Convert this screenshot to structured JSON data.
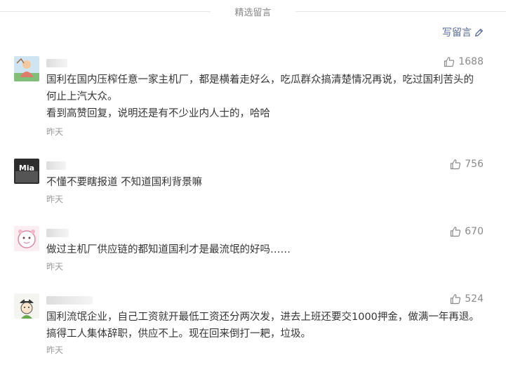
{
  "header": {
    "title": "精选留言"
  },
  "write_comment": {
    "label": "写留言",
    "icon": "pencil-icon"
  },
  "comments": [
    {
      "likes": "1688",
      "content": "国利在国内压榨任意一家主机厂，都是横着走好么，吃瓜群众搞清楚情况再说，吃过国利苦头的何止上汽大众。\n看到高赞回复，说明还是有不少业内人士的，哈哈",
      "time": "昨天"
    },
    {
      "likes": "756",
      "avatar_text": "Mia",
      "content": "不懂不要瞎报道 不知道国利背景嘛",
      "time": "昨天"
    },
    {
      "likes": "670",
      "content": "做过主机厂供应链的都知道国利才是最流氓的好吗……",
      "time": "昨天"
    },
    {
      "likes": "524",
      "content": "国利流氓企业，自己工资就开最低工资还分两次发，进去上班还要交1000押金，做满一年再退。搞得工人集体辞职，供应不上。现在回来倒打一耙，垃圾。",
      "time": "昨天"
    }
  ],
  "colors": {
    "link": "#576b95",
    "text": "#353535",
    "muted": "#9a9a9a"
  }
}
